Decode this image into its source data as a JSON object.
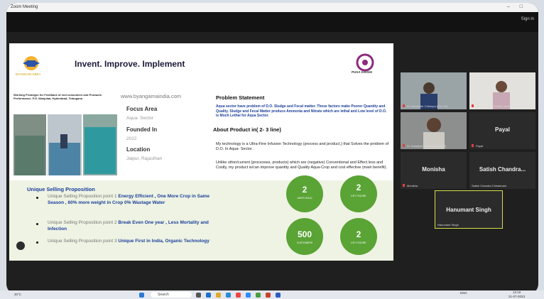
{
  "window": {
    "title": "Zoom Meeting",
    "controls": [
      "–",
      "□"
    ]
  },
  "meeting": {
    "sign_in": "Sign in"
  },
  "slide": {
    "title": "Invent. Improve. Implement",
    "logo_left_caption": "BYANGAM INDIA",
    "logo_right_caption": "PUSA KRISHI",
    "image_title": "Working Prototype for Feedback of end consumers and Products Performance. P.G. Manjulaa, Hyderabad, Telangana",
    "website": "www.byangamaindia.com",
    "focus_area_label": "Focus Area",
    "focus_area_value": "Aqua- Sector",
    "founded_label": "Founded In",
    "founded_value": "2022",
    "location_label": "Location",
    "location_value": "Jaipur, Rajasthan",
    "problem_heading": "Problem Statement",
    "problem_text": "Aqua sector have problem of D.O. Sludge and Fecal matter. These factors make Poorer Quantity and Quality. Sludge and Fecal Matter produce Ammonia and Nitrate which are lethal and Low level of D.O. is Much Lethal for Aqua Sector.",
    "about_heading": "About Product in( 2- 3 line)",
    "about_text_1": "My technology is a Ultra-Fine Infusion Technology (process and product,) that Solves the problem of D.O. In Aqua- Sector .",
    "about_text_2": "Unlike other/current (processes, products) which are (negative) Conventional and Effect less and Costly, my product is/can improve quantity and Quality Aqua-Crop and cost effective (main benefit).",
    "usp_heading": "Unique Selling Proposition",
    "usp": [
      {
        "prefix": "Unique Selling Proposition point 1 ",
        "highlight": "Energy Efficient , One More Crop in Same Season , 60% more weight in Crop 0% Wastage Water"
      },
      {
        "prefix": "Unique Selling Proposition point 2 ",
        "highlight": "Break Even One year , Less Mortality and Infection"
      },
      {
        "prefix": "Unique Selling Proposition point 3 ",
        "highlight": "Unique First in India, Organic Technology"
      }
    ],
    "metrics": [
      {
        "value": "2",
        "label": "UNITS SOLD"
      },
      {
        "value": "2",
        "label": "KEY FIGURE"
      },
      {
        "value": "500",
        "label": "CUSTOMERS"
      },
      {
        "value": "2",
        "label": "KEY FIGURE"
      }
    ]
  },
  "participants": [
    {
      "name": "Dr. Devender Chhimpa (Ext. Dir)",
      "type": "video"
    },
    {
      "name": "Sakshi (PUSA Krishi | Innovation)",
      "type": "video"
    },
    {
      "name": "Dr. Amarjeet Pusa Krishi (IARI)",
      "type": "video"
    },
    {
      "name": "Payal",
      "type": "name"
    },
    {
      "name": "Monisha",
      "type": "name"
    },
    {
      "name": "Satish Chandra...",
      "label": "Satish Chandra Chintamani",
      "type": "name"
    },
    {
      "name": "Hanumant Singh",
      "type": "name",
      "active": true
    }
  ],
  "taskbar": {
    "weather": "30°C",
    "search": "Search",
    "lang": "ENG",
    "time": "12:10",
    "date": "21-07-2023"
  },
  "colors": {
    "accent_blue": "#1b3e9c",
    "metric_green": "#5aa335",
    "active_border": "#d6e04a"
  }
}
